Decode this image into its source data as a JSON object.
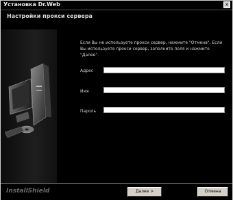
{
  "window": {
    "title": "Установка Dr.Web",
    "close_glyph": "×"
  },
  "header": {
    "title": "Настройки прокси сервера"
  },
  "main": {
    "info_text": "Если Вы не используете прокси сервер, нажмите \"Отмена\". Если Вы используете прокси сервер, заполните поля и нажмите \"Далее\".",
    "fields": [
      {
        "label": "Адрес",
        "value": "",
        "placeholder": ""
      },
      {
        "label": "Имя",
        "value": "",
        "placeholder": ""
      },
      {
        "label": "Пароль",
        "value": "",
        "placeholder": ""
      }
    ]
  },
  "footer": {
    "brand": "InstallShield",
    "next_label": "Далее >",
    "cancel_label": "Отмена"
  },
  "icons": {
    "side_art": "computer-icon",
    "close": "close-icon"
  }
}
